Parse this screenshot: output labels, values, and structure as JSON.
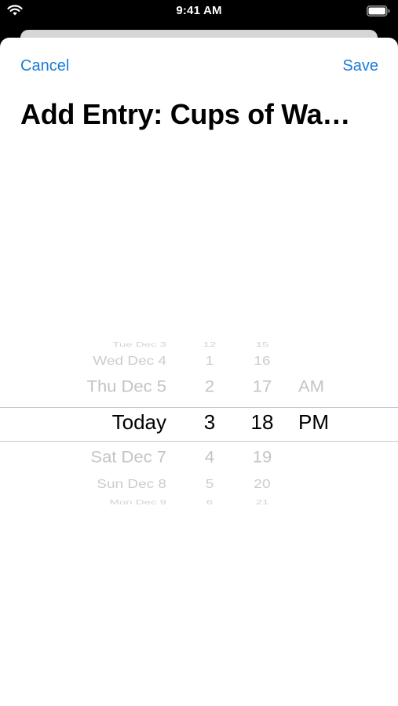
{
  "status_bar": {
    "time": "9:41 AM",
    "wifi_icon": "wifi-icon",
    "battery_icon": "battery-icon"
  },
  "nav": {
    "cancel_label": "Cancel",
    "save_label": "Save",
    "title": "Add Entry: Cups of Wa…"
  },
  "picker": {
    "dates": [
      "Tue Dec 3",
      "Wed Dec 4",
      "Thu Dec 5",
      "Today",
      "Sat Dec 7",
      "Sun Dec 8",
      "Mon Dec 9"
    ],
    "hours": [
      "12",
      "1",
      "2",
      "3",
      "4",
      "5",
      "6"
    ],
    "minutes": [
      "15",
      "16",
      "17",
      "18",
      "19",
      "20",
      "21"
    ],
    "periods": [
      "",
      "",
      "AM",
      "PM",
      "",
      "",
      ""
    ],
    "selected": {
      "date": "Today",
      "hour": "3",
      "minute": "18",
      "period": "PM"
    }
  },
  "colors": {
    "accent": "#1a7cd9",
    "selected_text": "#000000",
    "unselected_text": "#c4c4c4"
  }
}
